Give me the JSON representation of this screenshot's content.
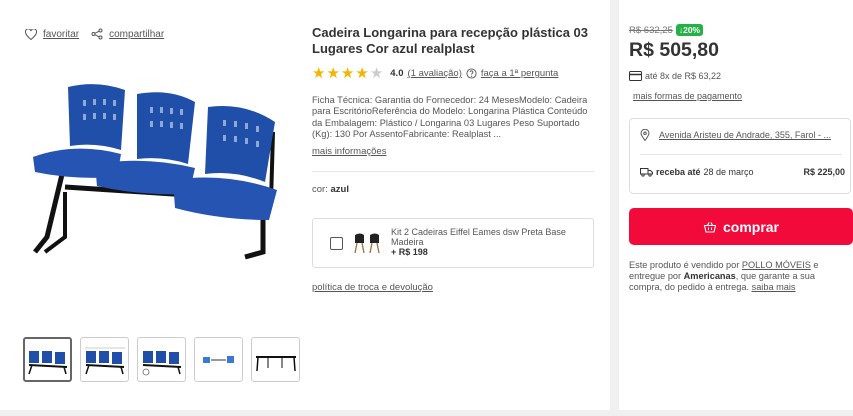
{
  "actions": {
    "favorite": "favoritar",
    "share": "compartilhar"
  },
  "product": {
    "title": "Cadeira Longarina para recepção plástica 03 Lugares Cor azul realplast",
    "rating": {
      "value": "4.0",
      "stars": 4,
      "count_label": "(1 avaliação)",
      "question_label": "faça a 1ª pergunta"
    },
    "description": "Ficha Técnica: Garantia do Fornecedor: 24 MesesModelo: Cadeira para EscritórioReferência do Modelo: Longarina Plástica Conteúdo da Embalagem: Plástico / Longarina 03 Lugares Peso Suportado (Kg): 130 Por AssentoFabricante: Realplast ...",
    "more_info": "mais informações",
    "color_label": "cor:",
    "color_value": "azul",
    "policy": "política de troca e devolução"
  },
  "kit": {
    "name": "Kit 2 Cadeiras Eiffel Eames dsw Preta Base Madeira",
    "price": "+ R$ 198"
  },
  "pricing": {
    "old_price": "R$ 632,25",
    "discount": "20%",
    "price": "R$ 505,80",
    "installments": "até 8x de R$ 63,22",
    "more_payment": "mais formas de pagamento"
  },
  "delivery": {
    "address": "Avenida Aristeu de Andrade, 355, Farol - ...",
    "receive_label": "receba até",
    "receive_date": "28 de março",
    "shipping_price": "R$ 225,00"
  },
  "buy_label": "comprar",
  "seller": {
    "prefix": "Este produto é vendido por",
    "seller_name": "POLLO MÓVEIS",
    "middle": "e entregue por",
    "deliverer": "Americanas",
    "suffix": ", que garante a sua compra, do pedido à entrega.",
    "learn_more": "saiba mais"
  },
  "colors": {
    "accent": "#f20a3a",
    "discount": "#26b048",
    "star": "#f5b400",
    "chair": "#1f4fa8"
  },
  "icons": [
    "heart-icon",
    "share-icon",
    "question-icon",
    "card-icon",
    "location-pin-icon",
    "truck-icon",
    "basket-icon"
  ]
}
